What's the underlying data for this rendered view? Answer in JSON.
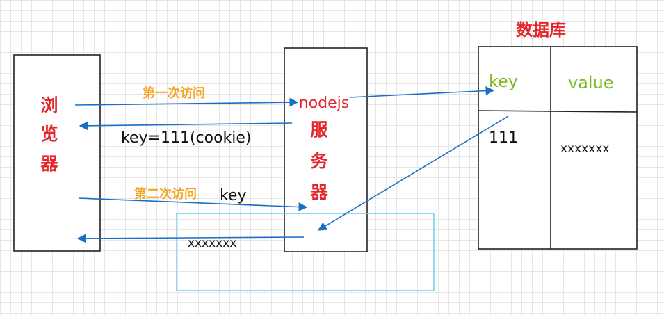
{
  "browser": {
    "label_chars": [
      "浏",
      "览",
      "器"
    ]
  },
  "server": {
    "name": "nodejs",
    "label_chars": [
      "服",
      "务",
      "器"
    ]
  },
  "database": {
    "title": "数据库",
    "header_key": "key",
    "header_value": "value",
    "row_key": "111",
    "row_value": "xxxxxxx"
  },
  "arrows": {
    "first_visit": "第一次访问",
    "response_cookie": "key=111(cookie)",
    "second_visit": "第二次访问",
    "second_visit_key": "key",
    "returned_value": "xxxxxxx"
  },
  "colors": {
    "arrow": "#1a6fc4",
    "label_red": "#e5262c",
    "label_orange": "#f5a623",
    "db_green": "#7cbb1f",
    "highlight_box": "#74d0f0"
  }
}
